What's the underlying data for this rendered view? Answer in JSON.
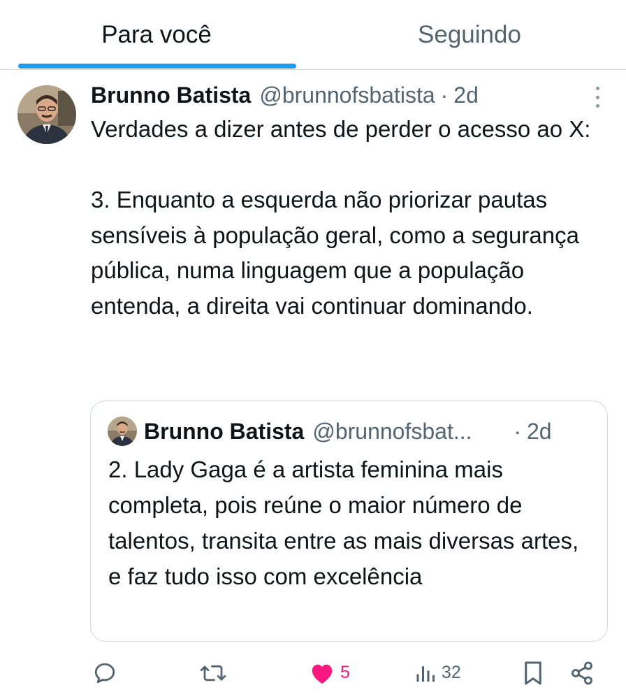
{
  "tabs": {
    "for_you": "Para você",
    "following": "Seguindo"
  },
  "tweet": {
    "name": "Brunno Batista",
    "handle": "@brunnofsbatista",
    "separator": "·",
    "time": "2d",
    "text": "Verdades a dizer antes de perder o acesso ao X:\n\n3. Enquanto a esquerda não priorizar pautas sensíveis à população geral, como a segurança pública, numa linguagem que a população entenda, a direita vai continuar dominando."
  },
  "quote": {
    "name": "Brunno Batista",
    "handle": "@brunnofsbat...",
    "separator": "·",
    "time": "2d",
    "text": "2. Lady Gaga é a artista feminina mais completa, pois reúne o maior número de talentos, transita entre as mais diversas artes, e faz tudo isso com excelência"
  },
  "actions": {
    "likes": "5",
    "views": "32"
  },
  "icons": [
    "reply-icon",
    "retweet-icon",
    "heart-icon",
    "views-icon",
    "bookmark-icon",
    "share-icon",
    "more-icon"
  ],
  "colors": {
    "accent": "#1d9bf0",
    "like": "#f91880",
    "secondary_text": "#536471"
  }
}
